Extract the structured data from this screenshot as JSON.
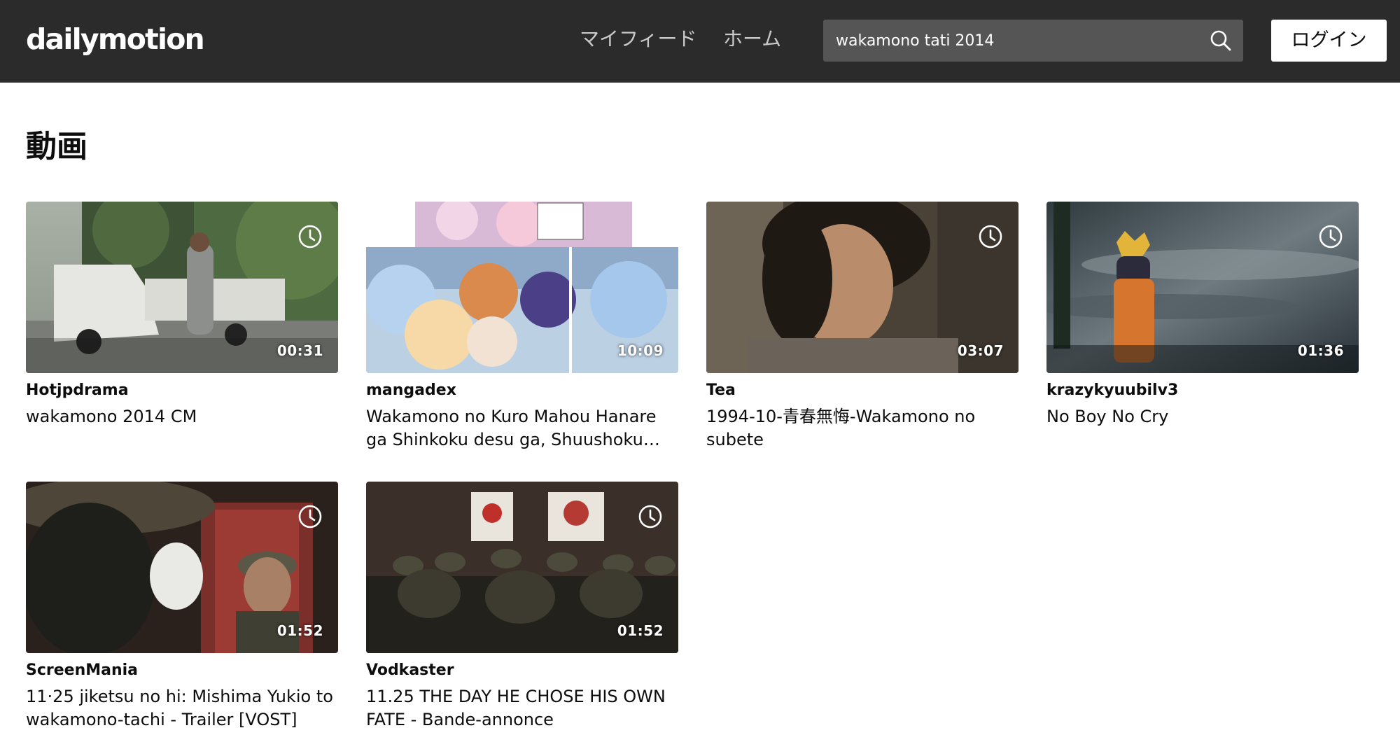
{
  "header": {
    "logo": "dailymotion",
    "nav": {
      "my_feed": "マイフィード",
      "home": "ホーム"
    },
    "search": {
      "value": "wakamono tati 2014"
    },
    "login_label": "ログイン"
  },
  "section": {
    "title": "動画"
  },
  "videos": [
    {
      "channel": "Hotjpdrama",
      "title": "wakamono 2014 CM",
      "duration": "00:31",
      "watch_later": true
    },
    {
      "channel": "mangadex",
      "title": "Wakamono no Kuro Mahou Hanare ga Shinkoku desu ga, Shuushoku shite...",
      "duration": "10:09",
      "watch_later": false
    },
    {
      "channel": "Tea",
      "title": "1994-10-青春無悔-Wakamono no subete",
      "duration": "03:07",
      "watch_later": true
    },
    {
      "channel": "krazykyuubilv3",
      "title": "No Boy No Cry",
      "duration": "01:36",
      "watch_later": true
    },
    {
      "channel": "ScreenMania",
      "title": "11·25 jiketsu no hi: Mishima Yukio to wakamono-tachi - Trailer [VOST]",
      "duration": "01:52",
      "watch_later": true
    },
    {
      "channel": "Vodkaster",
      "title": "11.25 THE DAY HE CHOSE HIS OWN FATE - Bande-annonce",
      "duration": "01:52",
      "watch_later": true
    }
  ],
  "icons": {
    "search": "search-icon",
    "watch_later": "clock-icon"
  },
  "colors": {
    "header_bg": "#2b2b2b",
    "search_bg": "#555555",
    "login_bg": "#ffffff",
    "page_bg": "#ffffff"
  }
}
